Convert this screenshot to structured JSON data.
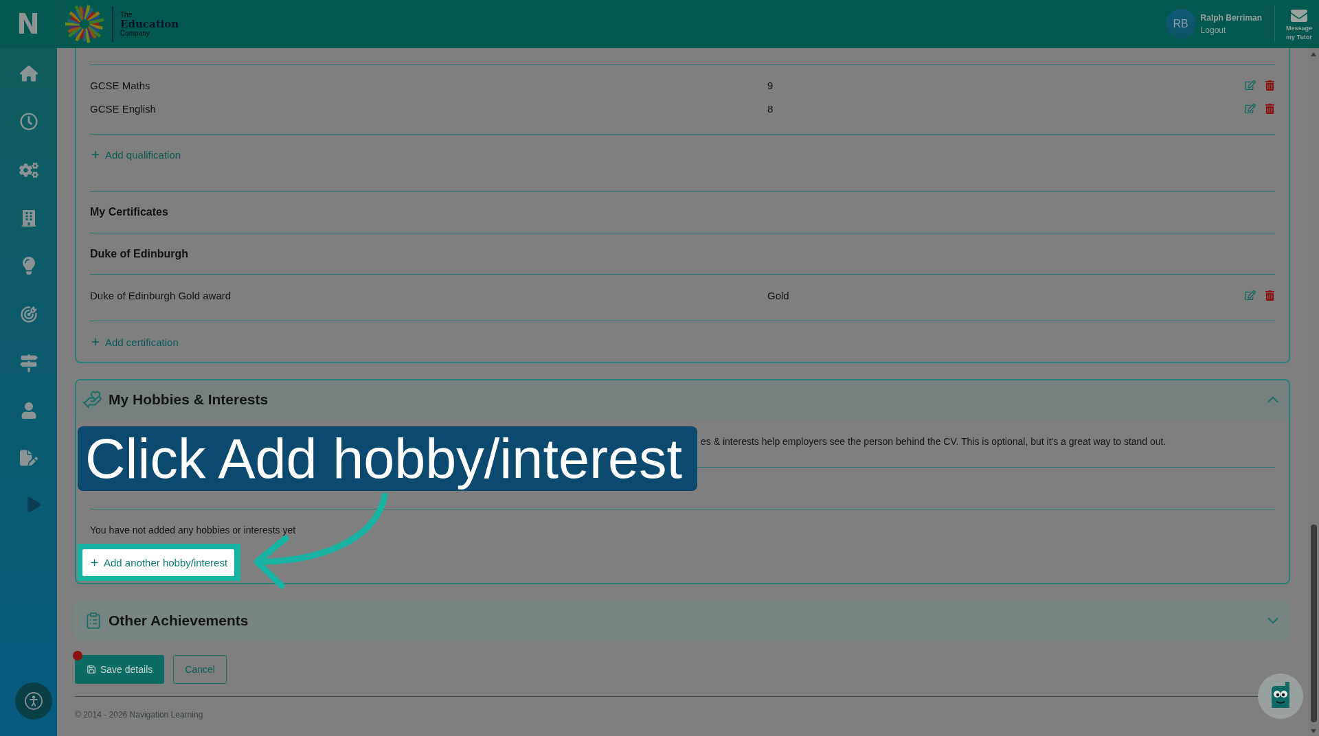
{
  "header": {
    "app_logo": "N",
    "brand": {
      "kicker": "The",
      "name": "Education",
      "tagline": "Company"
    },
    "user": {
      "initials": "RB",
      "name": "Ralph Berriman",
      "logout": "Logout"
    },
    "message_tutor": [
      "Message",
      "my Tutor"
    ]
  },
  "qualifications": {
    "rows": [
      {
        "name": "GCSE Maths",
        "grade": "9"
      },
      {
        "name": "GCSE English",
        "grade": "8"
      }
    ],
    "add_label": "Add qualification"
  },
  "certificates": {
    "title": "My Certificates",
    "groups": [
      {
        "title": "Duke of Edinburgh",
        "items": [
          {
            "name": "Duke of Edinburgh Gold award",
            "award": "Gold"
          }
        ]
      }
    ],
    "add_label": "Add certification"
  },
  "hobbies": {
    "title": "My Hobbies & Interests",
    "expanded": true,
    "intro": "es & interests help employers see the person behind the CV. This is optional, but it's a great way to stand out.",
    "empty_message": "You have not added any hobbies or interests yet",
    "add_button": {
      "label": "Add another hobby/interest",
      "highlighted": true
    }
  },
  "achievements": {
    "title": "Other Achievements",
    "expanded": false
  },
  "actions": {
    "save": {
      "label": "Save details",
      "unsaved": true
    },
    "cancel": "Cancel"
  },
  "footer": "© 2014 - 2026 Navigation Learning",
  "tutorial": {
    "callout": "Click Add hobby/interest"
  }
}
